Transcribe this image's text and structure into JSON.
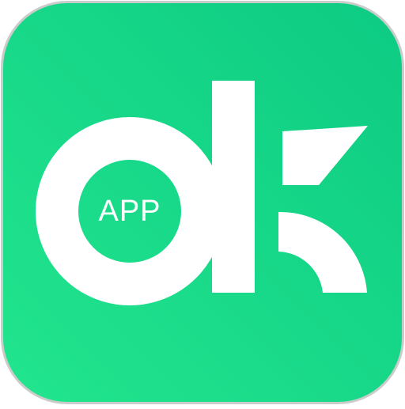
{
  "app_icon": {
    "label": "APP",
    "colors": {
      "gradient_start": "#22E58E",
      "gradient_end": "#0DCB83",
      "border": "#C9CCCA",
      "glyph": "#FFFFFF"
    }
  }
}
